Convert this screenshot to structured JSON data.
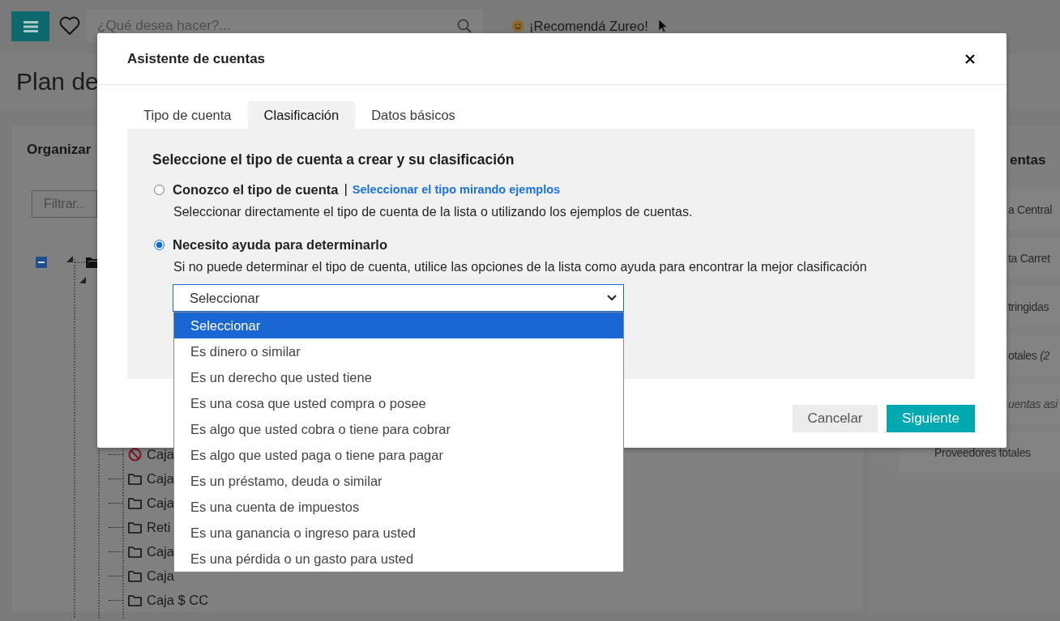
{
  "topbar": {
    "search": {
      "placeholder": "¿Qué desea hacer?..."
    },
    "recommend": "¡Recomendá Zureo!"
  },
  "page_title": "Plan de",
  "left_panel": {
    "title": "Organizar",
    "filter": {
      "placeholder": "Filtrar..."
    },
    "tree_items": [
      {
        "label": "Caja",
        "kind": "blocked"
      },
      {
        "label": "Caja",
        "kind": "folder"
      },
      {
        "label": "Caja",
        "kind": "folder"
      },
      {
        "label": "Reti",
        "kind": "folder"
      },
      {
        "label": "Caja",
        "kind": "folder"
      },
      {
        "label": "Caja",
        "kind": "folder"
      },
      {
        "label": "Caja $ CC",
        "kind": "folder"
      }
    ]
  },
  "right_panel": {
    "title": "entas",
    "items": [
      {
        "text": "a Central",
        "kind": "cut"
      },
      {
        "text": "ta Carret",
        "kind": "cut"
      },
      {
        "text": "tringidas",
        "kind": "cut"
      },
      {
        "text": "otales *(2*",
        "kind": "cut"
      },
      {
        "text": "uentas asi",
        "kind": "note"
      },
      {
        "text": "Proveedores totales",
        "kind": "full"
      }
    ]
  },
  "dialog": {
    "title": "Asistente de cuentas",
    "tabs": [
      {
        "label": "Tipo de cuenta",
        "selected": false
      },
      {
        "label": "Clasificación",
        "selected": true
      },
      {
        "label": "Datos básicos",
        "selected": false
      }
    ],
    "heading": "Seleccione el tipo de cuenta a crear y su clasificación",
    "options": [
      {
        "label": "Conozco el tipo de cuenta",
        "separator": "|",
        "link": "Seleccionar el tipo mirando ejemplos",
        "description": "Seleccionar directamente el tipo de cuenta de la lista o utilizando los ejemplos de cuentas.",
        "selected": false
      },
      {
        "label": "Necesito ayuda para determinarlo",
        "description": "Si no puede determinar el tipo de cuenta, utilice las opciones de la lista como ayuda para encontrar la mejor clasificación",
        "selected": true
      }
    ],
    "select": {
      "value": "Seleccionar",
      "options": [
        {
          "label": "Seleccionar",
          "selected": true
        },
        {
          "label": "Es dinero o similar",
          "selected": false
        },
        {
          "label": "Es un derecho que usted tiene",
          "selected": false
        },
        {
          "label": "Es una cosa que usted compra o posee",
          "selected": false
        },
        {
          "label": "Es algo que usted cobra o tiene para cobrar",
          "selected": false
        },
        {
          "label": "Es algo que usted paga o tiene para pagar",
          "selected": false
        },
        {
          "label": "Es un préstamo, deuda o similar",
          "selected": false
        },
        {
          "label": "Es una cuenta de impuestos",
          "selected": false
        },
        {
          "label": "Es una ganancia o ingreso para usted",
          "selected": false
        },
        {
          "label": "Es una pérdida o un gasto para usted",
          "selected": false
        }
      ]
    },
    "buttons": {
      "cancel": "Cancelar",
      "next": "Siguiente"
    }
  }
}
